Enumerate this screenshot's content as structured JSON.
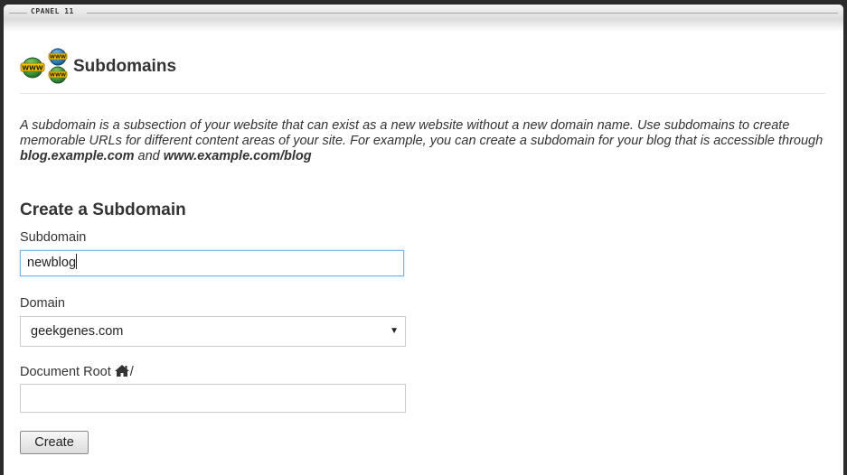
{
  "header": {
    "brand": "CPANEL 11"
  },
  "page": {
    "title": "Subdomains",
    "icon": "www-globes-icon"
  },
  "description": {
    "text_1": "A subdomain is a subsection of your website that can exist as a new website without a new domain name. Use subdomains to create memorable URLs for different content areas of your site. For example, you can create a subdomain for your blog that is accessible through ",
    "example_1": "blog.example.com",
    "text_2": " and ",
    "example_2": "www.example.com/blog"
  },
  "form": {
    "section_title": "Create a Subdomain",
    "subdomain": {
      "label": "Subdomain",
      "value": "newblog"
    },
    "domain": {
      "label": "Domain",
      "selected": "geekgenes.com"
    },
    "document_root": {
      "label": "Document Root",
      "path_suffix": "/",
      "value": ""
    },
    "create_label": "Create"
  },
  "colors": {
    "text": "#333333",
    "focus_border": "#7fb2e5",
    "panel_background": "#ffffff"
  }
}
